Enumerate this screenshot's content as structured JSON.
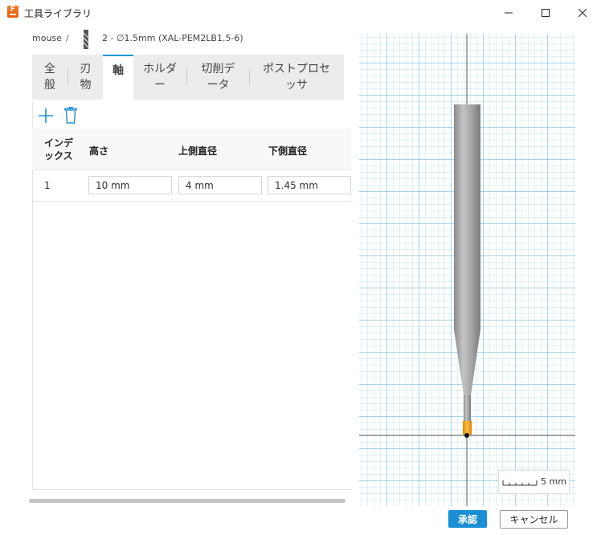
{
  "window": {
    "title": "工具ライブラリ",
    "app_icon_letter": "F"
  },
  "breadcrumb": {
    "root": "mouse",
    "separator": "/",
    "tool": "2 - ∅1.5mm (XAL-PEM2LB1.5-6)"
  },
  "tabs": [
    {
      "label": "全\n般"
    },
    {
      "label": "刃\n物"
    },
    {
      "label": "軸"
    },
    {
      "label": "ホルダ\nー"
    },
    {
      "label": "切削デ\nータ"
    },
    {
      "label": "ポストプロセ\nッサ"
    }
  ],
  "table": {
    "headers": [
      "インデ\nックス",
      "高さ",
      "上側直径",
      "下側直径"
    ],
    "rows": [
      {
        "index": "1",
        "height": "10 mm",
        "upper_diameter": "4 mm",
        "lower_diameter": "1.45 mm"
      }
    ]
  },
  "preview": {
    "scale_label": "5 mm"
  },
  "footer": {
    "ok": "承認",
    "cancel": "キャンセル"
  },
  "colors": {
    "accent": "#1a8fd6",
    "tool_tip": "#f5a623",
    "shank": "#a9a9a9"
  },
  "icons": {
    "add": "plus-icon",
    "delete": "trash-icon",
    "minimize": "minimize-icon",
    "maximize": "maximize-icon",
    "close": "close-icon"
  }
}
